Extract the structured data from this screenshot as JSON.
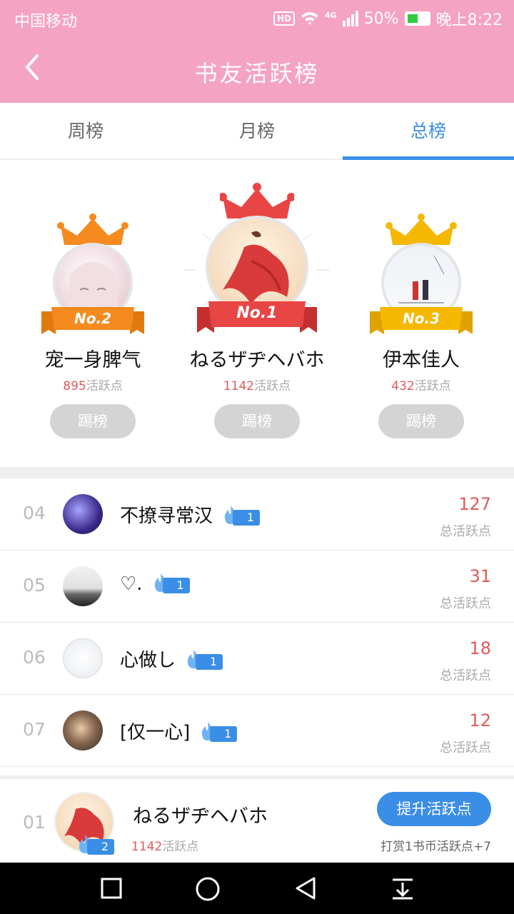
{
  "status_bar": {
    "carrier": "中国移动",
    "hd": "HD",
    "network": "4G",
    "battery": "50%",
    "time": "晚上8:22"
  },
  "header": {
    "title": "书友活跃榜"
  },
  "tabs": [
    {
      "label": "周榜",
      "active": false
    },
    {
      "label": "月榜",
      "active": false
    },
    {
      "label": "总榜",
      "active": true
    }
  ],
  "podium": [
    {
      "rank_label": "No.1",
      "name": "ねるザヂヘバホ",
      "points": "1142",
      "points_suffix": "活跃点",
      "kick_label": "踢榜"
    },
    {
      "rank_label": "No.2",
      "name": "宠一身脾气",
      "points": "895",
      "points_suffix": "活跃点",
      "kick_label": "踢榜"
    },
    {
      "rank_label": "No.3",
      "name": "伊本佳人",
      "points": "432",
      "points_suffix": "活跃点",
      "kick_label": "踢榜"
    }
  ],
  "list": [
    {
      "rank": "04",
      "name": "不撩寻常汉",
      "level": "1",
      "points": "127",
      "points_label": "总活跃点"
    },
    {
      "rank": "05",
      "name": "♡.",
      "level": "1",
      "points": "31",
      "points_label": "总活跃点"
    },
    {
      "rank": "06",
      "name": "心做し",
      "level": "1",
      "points": "18",
      "points_label": "总活跃点"
    },
    {
      "rank": "07",
      "name": "[仅一心]",
      "level": "1",
      "points": "12",
      "points_label": "总活跃点"
    }
  ],
  "my_rank": {
    "rank": "01",
    "name": "ねるザヂヘバホ",
    "level": "2",
    "points": "1142",
    "points_suffix": "活跃点",
    "boost_label": "提升活跃点",
    "tip": "打赏1书币活跃点+7"
  },
  "colors": {
    "header_pink": "#f5a3c2",
    "accent_blue": "#3a8ee6",
    "points_red": "#e05a5a",
    "gold": "#f5b800",
    "orange": "#f58a1f",
    "red": "#e84545"
  }
}
